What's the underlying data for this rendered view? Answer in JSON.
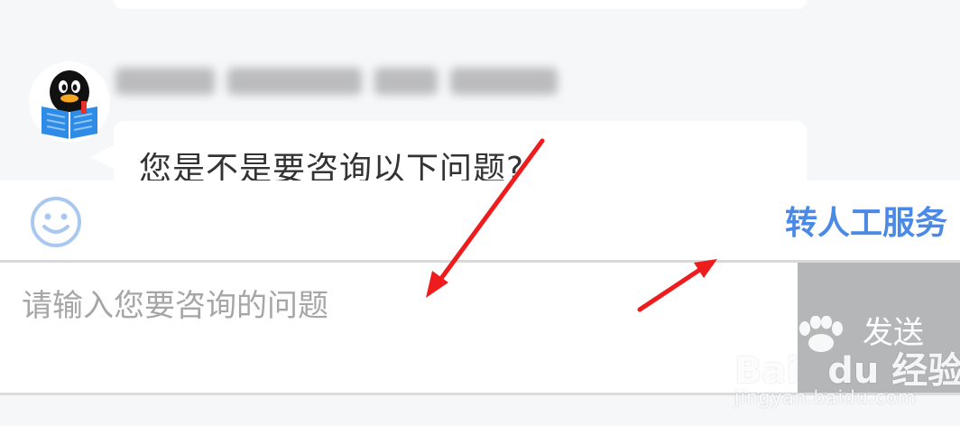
{
  "chat": {
    "message_text": "您是不是要咨询以下问题?"
  },
  "toolbar": {
    "emoji_icon": "smiley-face-icon",
    "human_service_label": "转人工服务",
    "accent_color": "#4a8ae6"
  },
  "composer": {
    "placeholder": "请输入您要咨询的问题",
    "send_label": "发送",
    "send_bg_color": "#b4b6b8"
  },
  "avatar": {
    "icon": "qq-penguin-reading-icon"
  },
  "annotations": {
    "arrow_color": "#ee1c1c"
  },
  "watermark": {
    "logo_text": "Bai",
    "logo_du": "du",
    "logo_suffix": "经验",
    "url_text": "jingyan.baidu.com"
  }
}
